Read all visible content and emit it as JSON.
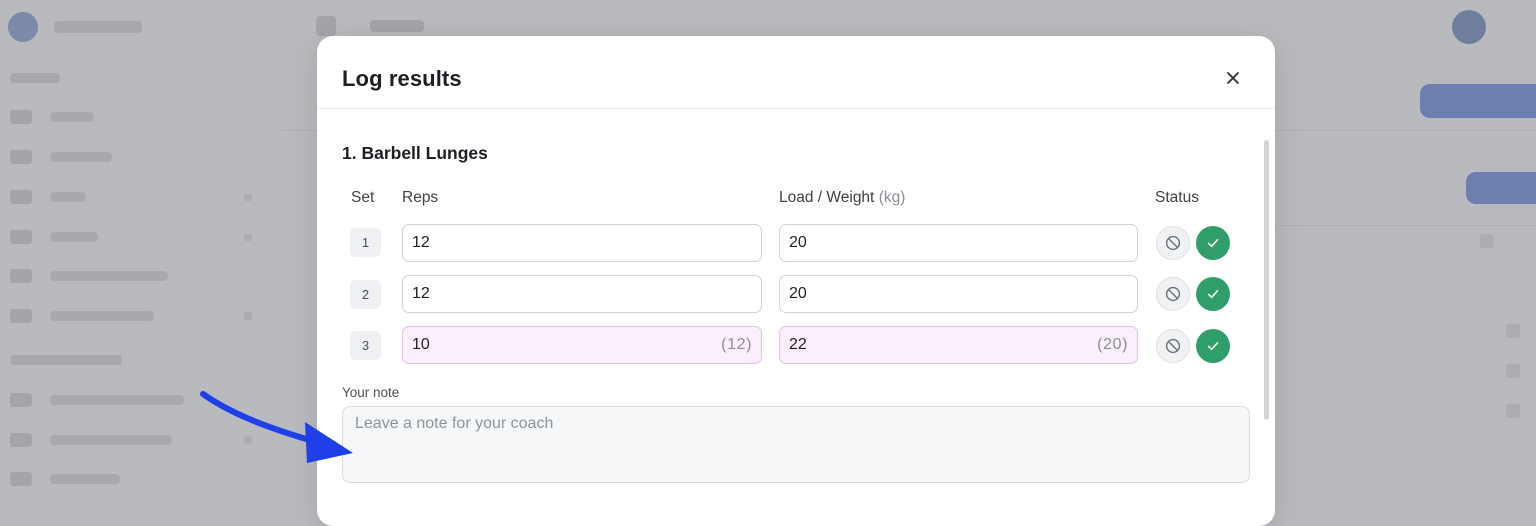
{
  "modal": {
    "title": "Log results",
    "exercise_title": "1. Barbell Lunges",
    "columns": {
      "set": "Set",
      "reps": "Reps",
      "load": "Load / Weight",
      "load_unit": "(kg)",
      "status": "Status"
    },
    "sets": [
      {
        "number": "1",
        "reps": "12",
        "reps_original": "",
        "load": "20",
        "load_original": "",
        "modified": false
      },
      {
        "number": "2",
        "reps": "12",
        "reps_original": "",
        "load": "20",
        "load_original": "",
        "modified": false
      },
      {
        "number": "3",
        "reps": "10",
        "reps_original": "(12)",
        "load": "22",
        "load_original": "(20)",
        "modified": true
      }
    ],
    "note": {
      "label": "Your note",
      "placeholder": "Leave a note for your coach",
      "value": ""
    }
  },
  "colors": {
    "done_green": "#2f9e6a",
    "modified_bg": "#fbeffc",
    "annotation_arrow": "#1f3fe8",
    "overlay": "#b9babd"
  },
  "icons": {
    "close": "close-icon",
    "skip": "block-icon",
    "done": "check-icon",
    "annotation": "arrow-icon"
  }
}
